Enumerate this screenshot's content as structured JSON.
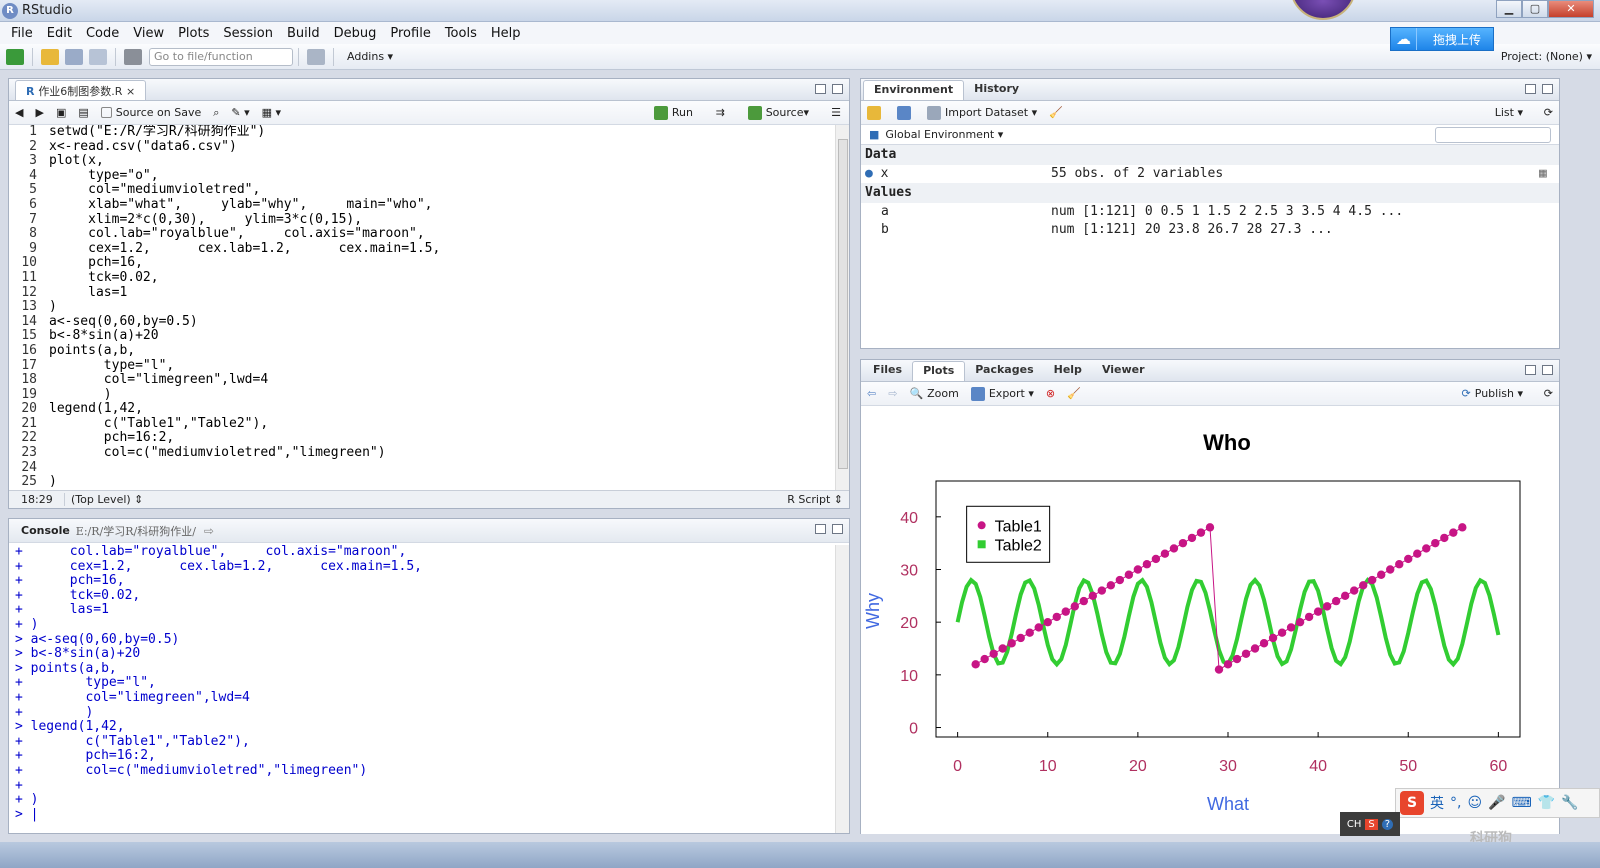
{
  "window": {
    "title": "RStudio",
    "app_icon": "R",
    "min": "▁",
    "max": "▢",
    "close": "✕"
  },
  "menu": [
    "File",
    "Edit",
    "Code",
    "View",
    "Plots",
    "Session",
    "Build",
    "Debug",
    "Profile",
    "Tools",
    "Help"
  ],
  "toolbar": {
    "goto_placeholder": "Go to file/function",
    "addins": "Addins ▾"
  },
  "baidu": {
    "label": "拖拽上传"
  },
  "project": {
    "label": "Project: (None) ▾"
  },
  "editor": {
    "tab": "作业6制图参数.R",
    "source_on_save": "Source on Save",
    "run": "Run",
    "source": "Source",
    "lines": [
      {
        "n": "1",
        "t": "setwd(\"E:/R/学习R/科研狗作业\")"
      },
      {
        "n": "2",
        "t": "x<-read.csv(\"data6.csv\")"
      },
      {
        "n": "3",
        "t": "plot(x,"
      },
      {
        "n": "4",
        "t": "     type=\"o\","
      },
      {
        "n": "5",
        "t": "     col=\"mediumvioletred\","
      },
      {
        "n": "6",
        "t": "     xlab=\"what\",     ylab=\"why\",     main=\"who\","
      },
      {
        "n": "7",
        "t": "     xlim=2*c(0,30),     ylim=3*c(0,15),"
      },
      {
        "n": "8",
        "t": "     col.lab=\"royalblue\",     col.axis=\"maroon\","
      },
      {
        "n": "9",
        "t": "     cex=1.2,      cex.lab=1.2,      cex.main=1.5,"
      },
      {
        "n": "10",
        "t": "     pch=16,"
      },
      {
        "n": "11",
        "t": "     tck=0.02,"
      },
      {
        "n": "12",
        "t": "     las=1"
      },
      {
        "n": "13",
        "t": ")"
      },
      {
        "n": "14",
        "t": "a<-seq(0,60,by=0.5)"
      },
      {
        "n": "15",
        "t": "b<-8*sin(a)+20"
      },
      {
        "n": "16",
        "t": "points(a,b,"
      },
      {
        "n": "17",
        "t": "       type=\"l\","
      },
      {
        "n": "18",
        "t": "       col=\"limegreen\",lwd=4"
      },
      {
        "n": "19",
        "t": "       )"
      },
      {
        "n": "20",
        "t": "legend(1,42,"
      },
      {
        "n": "21",
        "t": "       c(\"Table1\",\"Table2\"),"
      },
      {
        "n": "22",
        "t": "       pch=16:2,"
      },
      {
        "n": "23",
        "t": "       col=c(\"mediumvioletred\",\"limegreen\")"
      },
      {
        "n": "24",
        "t": ""
      },
      {
        "n": "25",
        "t": ")"
      }
    ],
    "status_pos": "18:29",
    "status_level": "(Top Level) ⇕",
    "status_type": "R Script ⇕"
  },
  "console": {
    "title": "Console",
    "path": "E:/R/学习R/科研狗作业/",
    "lines": [
      "+      col.lab=\"royalblue\",     col.axis=\"maroon\",",
      "+      cex=1.2,      cex.lab=1.2,      cex.main=1.5,",
      "+      pch=16,",
      "+      tck=0.02,",
      "+      las=1",
      "+ )",
      "> a<-seq(0,60,by=0.5)",
      "> b<-8*sin(a)+20",
      "> points(a,b,",
      "+        type=\"l\",",
      "+        col=\"limegreen\",lwd=4",
      "+        )",
      "> legend(1,42,",
      "+        c(\"Table1\",\"Table2\"),",
      "+        pch=16:2,",
      "+        col=c(\"mediumvioletred\",\"limegreen\")",
      "+",
      "+ )",
      "> |"
    ]
  },
  "environment": {
    "tabs": [
      "Environment",
      "History"
    ],
    "import": "Import Dataset ▾",
    "list": "List ▾",
    "scope": "Global Environment ▾",
    "data_header": "Data",
    "values_header": "Values",
    "data_rows": [
      {
        "name": "x",
        "value": "55 obs. of 2 variables"
      }
    ],
    "value_rows": [
      {
        "name": "a",
        "value": "num [1:121] 0 0.5 1 1.5 2 2.5 3 3.5 4 4.5 ..."
      },
      {
        "name": "b",
        "value": "num [1:121] 20 23.8 26.7 28 27.3 ..."
      }
    ]
  },
  "files": {
    "tabs": [
      "Files",
      "Plots",
      "Packages",
      "Help",
      "Viewer"
    ],
    "zoom": "Zoom",
    "export": "Export ▾",
    "publish": "Publish ▾"
  },
  "chart_data": {
    "type": "scatter",
    "title": "Who",
    "xlabel": "What",
    "ylabel": "Why",
    "xlim": [
      0,
      60
    ],
    "ylim": [
      0,
      45
    ],
    "xticks": [
      0,
      10,
      20,
      30,
      40,
      50,
      60
    ],
    "yticks": [
      0,
      10,
      20,
      30,
      40
    ],
    "colors": {
      "title": "#000000",
      "axis": "#b03060",
      "lab": "#4169e1",
      "points": "#c71585",
      "line": "#32cd32"
    },
    "legend": {
      "position": "top-left",
      "entries": [
        {
          "name": "Table1",
          "color": "#c71585",
          "shape": "circle"
        },
        {
          "name": "Table2",
          "color": "#32cd32",
          "shape": "square"
        }
      ]
    },
    "series": [
      {
        "name": "x",
        "kind": "points-line",
        "segments": [
          {
            "x_start": 2,
            "x_end": 28,
            "y_start": 12,
            "y_end": 38
          },
          {
            "x_start": 29,
            "x_end": 56,
            "y_start": 11,
            "y_end": 38
          }
        ],
        "count": 55
      },
      {
        "name": "sin",
        "kind": "line",
        "formula": "8*sin(a)+20",
        "x_from": 0,
        "x_to": 60,
        "x_step": 0.5
      }
    ]
  },
  "ime": {
    "label": "CH"
  },
  "sogou": {
    "lang": "英"
  },
  "watermark": "科研狗"
}
